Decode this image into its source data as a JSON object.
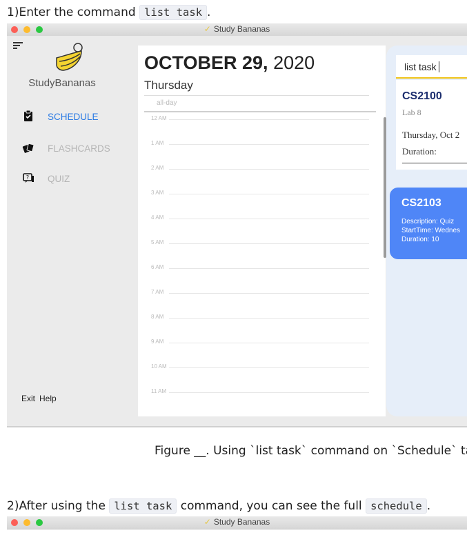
{
  "step1": {
    "prefix": "1)Enter the command ",
    "code": "list task",
    "suffix": "."
  },
  "window": {
    "title": "Study Bananas",
    "dot_colors": [
      "#fc5f57",
      "#fdbb2e",
      "#2ac841"
    ]
  },
  "sidebar": {
    "brand": "StudyBananas",
    "items": [
      {
        "label": "SCHEDULE",
        "icon": "clipboard-icon",
        "color": "#2a7ae4"
      },
      {
        "label": "FLASHCARDS",
        "icon": "flashcards-icon",
        "color": "#b5b5b5"
      },
      {
        "label": "QUIZ",
        "icon": "quiz-icon",
        "color": "#b5b5b5"
      }
    ],
    "footer": [
      "Exit",
      "Help"
    ]
  },
  "calendar": {
    "date_bold": "OCTOBER 29,",
    "year": "2020",
    "weekday": "Thursday",
    "allday": "all-day",
    "hours": [
      "12 AM",
      "1 AM",
      "2 AM",
      "3 AM",
      "4 AM",
      "5 AM",
      "6 AM",
      "7 AM",
      "8 AM",
      "9 AM",
      "10 AM",
      "11 AM"
    ]
  },
  "task_panel": {
    "command_input": "list task",
    "card1": {
      "code": "CS2100",
      "title": "Lab 8",
      "date": "Thursday, Oct 2",
      "duration": "Duration:"
    },
    "card2": {
      "code": "CS2103",
      "lines": [
        "Description:  Quiz",
        "StartTime:  Wednes",
        "Duration:  10"
      ]
    }
  },
  "caption": "Figure __. Using `list task` command on `Schedule` ta",
  "step2": {
    "prefix": "2)After using the ",
    "code1": "list task",
    "middle": " command, you can see the full ",
    "code2": "schedule",
    "suffix": "."
  }
}
